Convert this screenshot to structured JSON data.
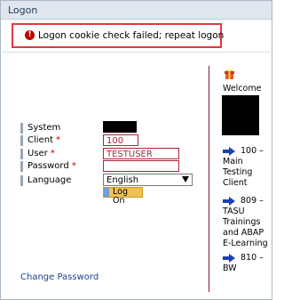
{
  "window": {
    "title": "Logon"
  },
  "message": {
    "icon": "error-exclamation-icon",
    "text": "Logon cookie check failed; repeat logon"
  },
  "form": {
    "system": {
      "label": "System"
    },
    "client": {
      "label": "Client",
      "required_mark": "*",
      "value": "100"
    },
    "user": {
      "label": "User",
      "required_mark": "*",
      "value": "TESTUSER"
    },
    "password": {
      "label": "Password",
      "required_mark": "*",
      "value": ""
    },
    "language": {
      "label": "Language",
      "value": "English"
    },
    "logon_button": {
      "label": "Log On"
    }
  },
  "links": {
    "change_password": "Change Password"
  },
  "sidebar": {
    "gift_icon": "gift-icon",
    "welcome": "Welcome",
    "entries": [
      {
        "icon": "right-arrow-icon",
        "line1": "100 –",
        "rest": "Main Testing Client"
      },
      {
        "icon": "right-arrow-icon",
        "line1": "809 –",
        "rest": "TASU Trainings and ABAP E-Learning"
      },
      {
        "icon": "right-arrow-icon",
        "line1": "810 –",
        "rest": "BW"
      }
    ]
  },
  "colors": {
    "error_border": "#e0393d",
    "field_border": "#b0223a",
    "button": "#f2c14e",
    "link": "#1d3f8c",
    "arrow": "#1a3fb5"
  }
}
